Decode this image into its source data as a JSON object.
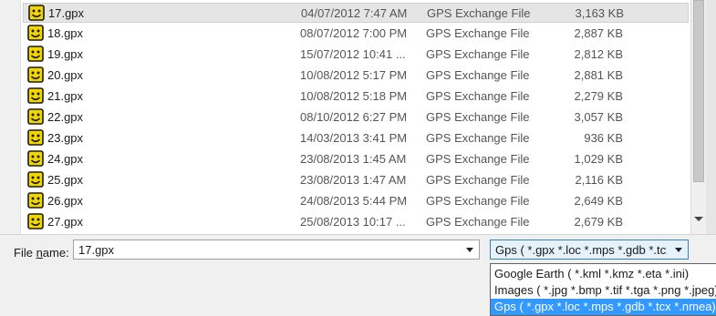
{
  "files": [
    {
      "name": "17.gpx",
      "date": "04/07/2012 7:47 AM",
      "type": "GPS Exchange File",
      "size": "3,163 KB",
      "selected": true
    },
    {
      "name": "18.gpx",
      "date": "08/07/2012 7:00 PM",
      "type": "GPS Exchange File",
      "size": "2,887 KB"
    },
    {
      "name": "19.gpx",
      "date": "15/07/2012 10:41 ...",
      "type": "GPS Exchange File",
      "size": "2,812 KB"
    },
    {
      "name": "20.gpx",
      "date": "10/08/2012 5:17 PM",
      "type": "GPS Exchange File",
      "size": "2,881 KB"
    },
    {
      "name": "21.gpx",
      "date": "10/08/2012 5:18 PM",
      "type": "GPS Exchange File",
      "size": "2,279 KB"
    },
    {
      "name": "22.gpx",
      "date": "08/10/2012 6:27 PM",
      "type": "GPS Exchange File",
      "size": "3,057 KB"
    },
    {
      "name": "23.gpx",
      "date": "14/03/2013 3:41 PM",
      "type": "GPS Exchange File",
      "size": "936 KB"
    },
    {
      "name": "24.gpx",
      "date": "23/08/2013 1:45 AM",
      "type": "GPS Exchange File",
      "size": "1,029 KB"
    },
    {
      "name": "25.gpx",
      "date": "23/08/2013 1:47 AM",
      "type": "GPS Exchange File",
      "size": "2,116 KB"
    },
    {
      "name": "26.gpx",
      "date": "24/08/2013 5:44 PM",
      "type": "GPS Exchange File",
      "size": "2,649 KB"
    },
    {
      "name": "27.gpx",
      "date": "25/08/2013 10:17 ...",
      "type": "GPS Exchange File",
      "size": "2,679 KB"
    }
  ],
  "file_icon": "gpx-file-icon",
  "filename": {
    "label_prefix": "File ",
    "label_accel": "n",
    "label_suffix": "ame:",
    "value": "17.gpx"
  },
  "filetype": {
    "selected": "Gps ( *.gpx *.loc *.mps *.gdb *.tcx *.nmea *.wpt *.plt *.csv *.txt *.ini )",
    "options": [
      "Google Earth ( *.kml *.kmz *.eta *.ini)",
      "Images ( *.jpg *.bmp *.tif *.tga *.png *.jpeg)",
      "Gps ( *.gpx *.loc *.mps *.gdb *.tcx *.nmea)"
    ],
    "highlighted_index": 2
  },
  "colors": {
    "selection": "#e5e5e5",
    "highlight": "#3399ff",
    "icon": "#f2d600"
  }
}
